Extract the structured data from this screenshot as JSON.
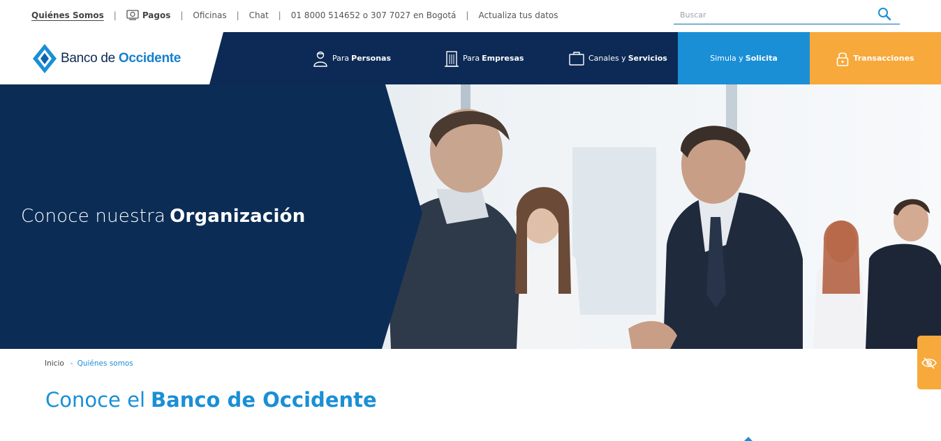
{
  "topbar": {
    "links": {
      "quienes": "Quiénes Somos",
      "pagos": "Pagos",
      "oficinas": "Oficinas",
      "chat": "Chat",
      "telefono": "01 8000 514652 o 307 7027 en Bogotá",
      "actualiza": "Actualiza tus datos"
    },
    "separator": "|",
    "search_placeholder": "Buscar"
  },
  "brand": {
    "name_part1": "Banco de ",
    "name_part2": "Occidente"
  },
  "nav": {
    "personas": {
      "prefix": "Para",
      "bold": "Personas"
    },
    "empresas": {
      "prefix": "Para",
      "bold": "Empresas"
    },
    "canales": {
      "prefix": "Canales y",
      "bold": "Servicios"
    },
    "simula": {
      "prefix": "Simula y",
      "bold": "Solicita"
    },
    "transacciones": "Transacciones"
  },
  "hero": {
    "title_light": "Conoce nuestra",
    "title_bold": "Organización"
  },
  "breadcrumb": {
    "home": "Inicio",
    "separator": "-",
    "current": "Quiénes somos"
  },
  "main": {
    "title_light": "Conoce el",
    "title_bold": "Banco de Occidente"
  },
  "colors": {
    "navy": "#0c2a55",
    "blue": "#1a8fd6",
    "orange": "#f7a93b"
  }
}
